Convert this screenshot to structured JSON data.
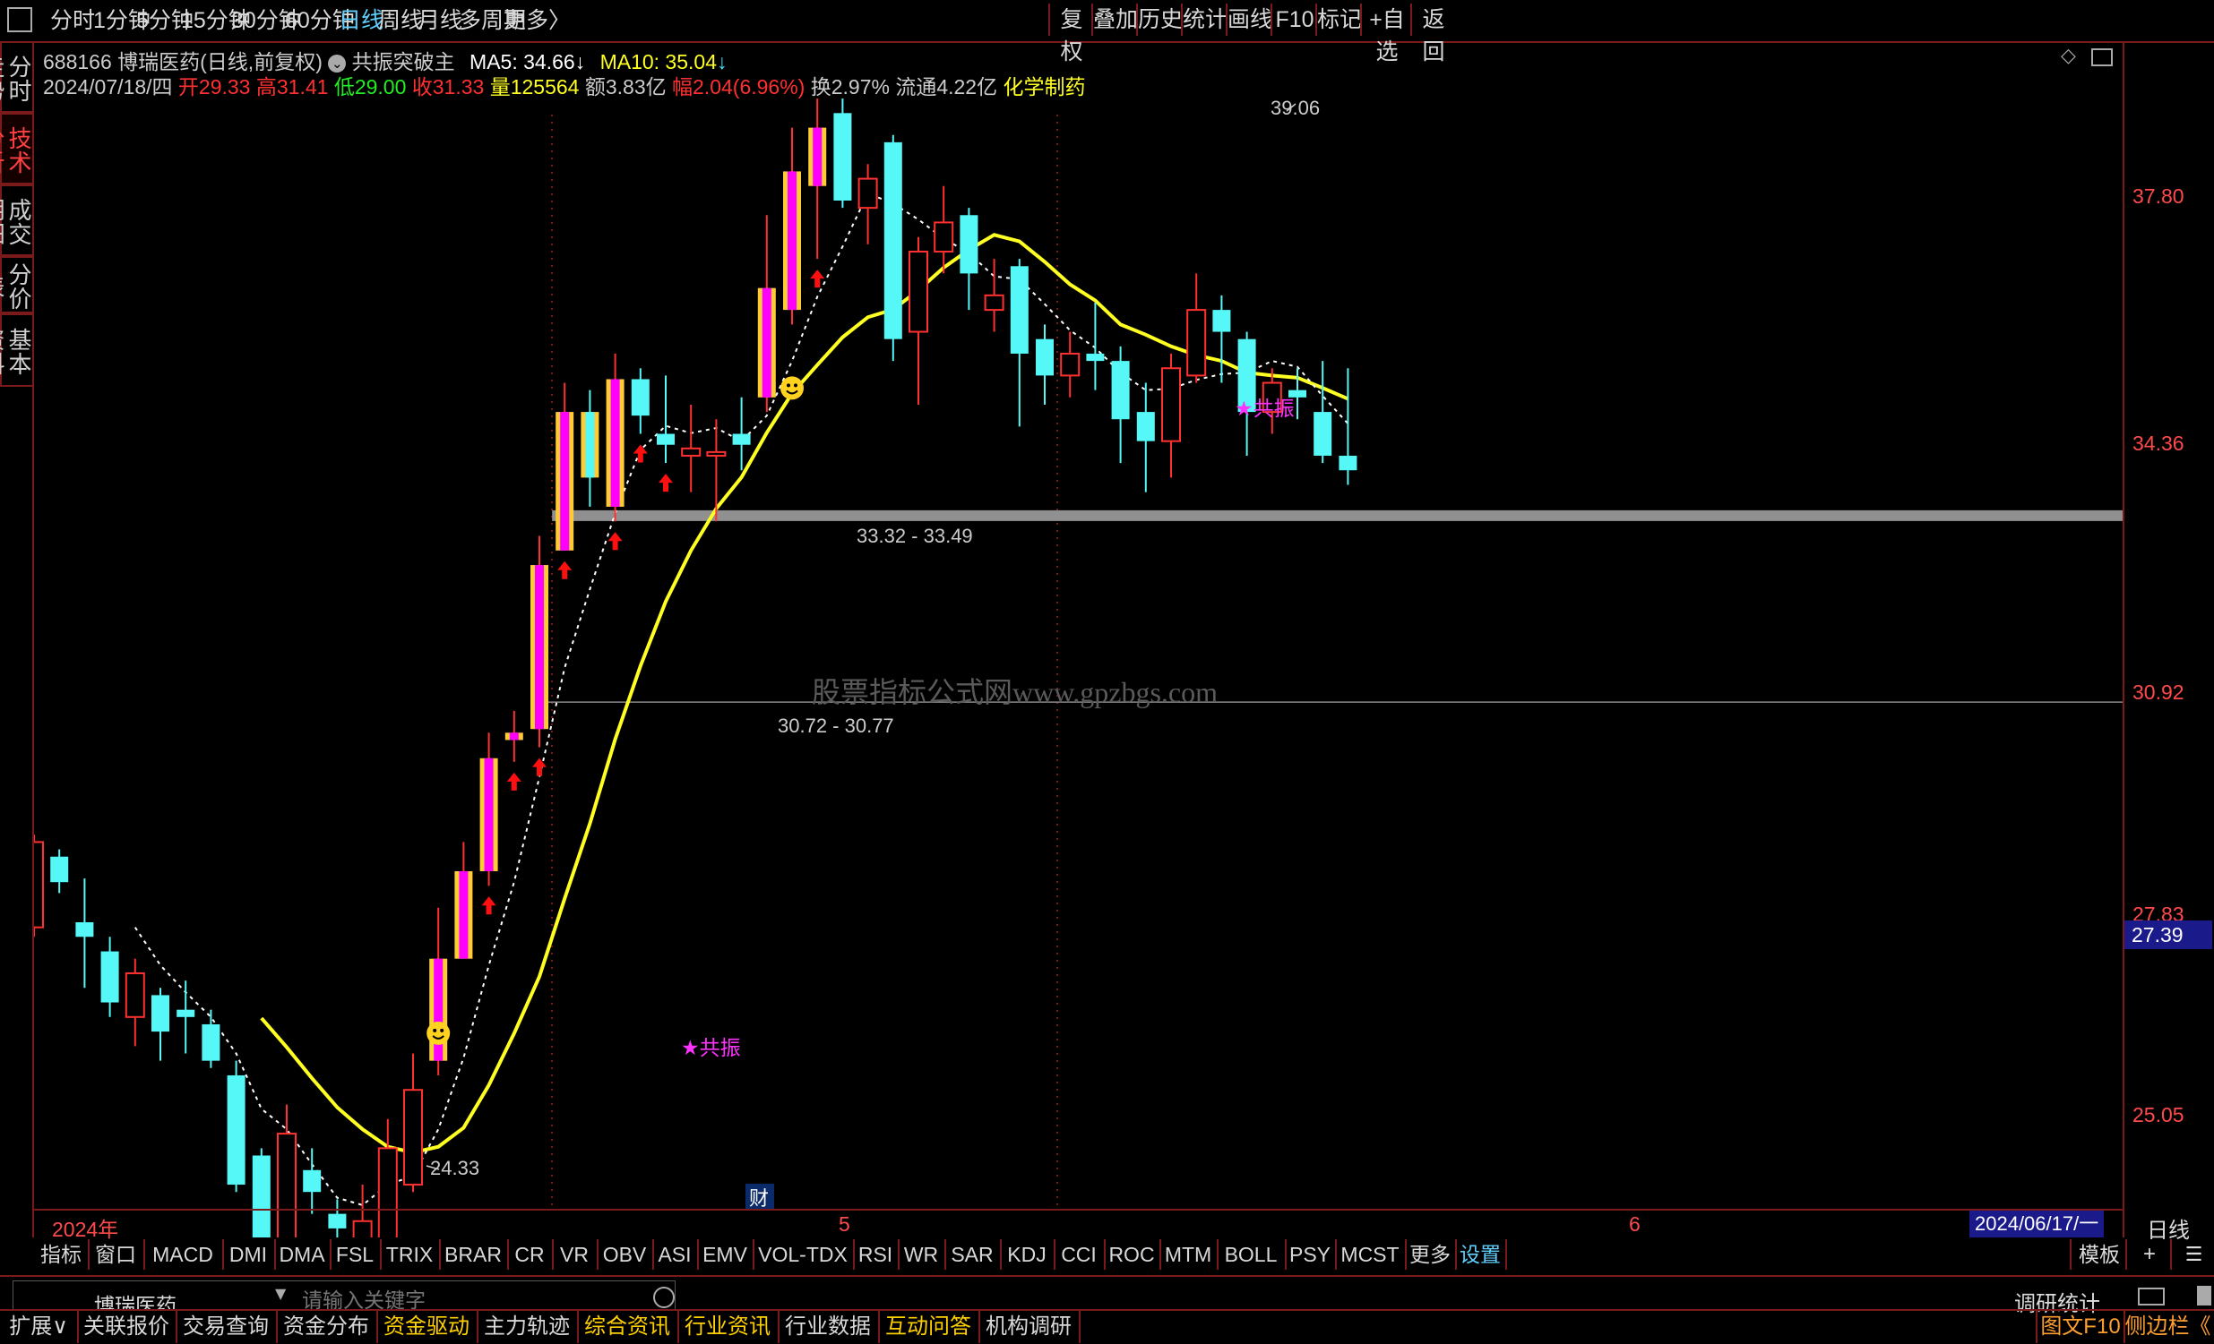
{
  "toolbar": {
    "periods": [
      "分时",
      "1分钟",
      "5分钟",
      "15分钟",
      "30分钟",
      "60分钟",
      "日线",
      "周线",
      "月线",
      "多周期",
      "更多"
    ],
    "active_period": "日线",
    "more_arrow": "〉",
    "right_buttons": [
      "复权",
      "叠加",
      "历史",
      "统计",
      "画线",
      "F10",
      "标记",
      "+自选",
      "返回"
    ]
  },
  "side_tabs": [
    {
      "label": "分时走势",
      "active": false
    },
    {
      "label": "技术分析",
      "active": true
    },
    {
      "label": "成交明细",
      "active": false
    },
    {
      "label": "分价表",
      "active": false
    },
    {
      "label": "基本资料",
      "active": false
    }
  ],
  "stock": {
    "code": "688166",
    "name": "博瑞医药",
    "mode": "(日线,前复权)",
    "indicator_name": "共振突破主",
    "ma5_label": "MA5: 34.66",
    "ma10_label": "MA10: 35.04",
    "down_arrow": "↓"
  },
  "quote": {
    "date": "2024/07/18/四",
    "open_label": "开",
    "open": "29.33",
    "high_label": "高",
    "high": "31.41",
    "low_label": "低",
    "low": "29.00",
    "close_label": "收",
    "close": "31.33",
    "vol_label": "量",
    "vol": "125564",
    "amount_label": "额",
    "amount": "3.83亿",
    "change_label": "幅",
    "change": "2.04(6.96%)",
    "turnover_label": "换",
    "turnover": "2.97%",
    "float_label": "流通",
    "float": "4.22亿",
    "sector": "化学制药"
  },
  "chart_data": {
    "type": "candlestick",
    "y_ticks": [
      "37.80",
      "34.36",
      "30.92",
      "27.83",
      "25.05"
    ],
    "current_price_label": "27.39",
    "annotations": {
      "high": "39.06",
      "low": "24.33",
      "band_upper": "33.32 - 33.49",
      "band_lower": "30.72 - 30.77",
      "signal_1": "★共振",
      "signal_2": "★共振",
      "finance_marker": "财",
      "watermark": "股票指标公式网www.gpzbgs.com"
    },
    "x_labels": [
      "2024年",
      "5",
      "6"
    ],
    "cursor_date": "2024/06/17/一",
    "period_label": "日线",
    "colors": {
      "up": "#ff3030",
      "down": "#55f7f7",
      "ma_yellow": "#ffff22",
      "ma_white": "#ffffff",
      "signal": "#ff33ff",
      "magenta_fill": "#ff00ff",
      "gold_fill": "#ffcc33",
      "band": "#909090"
    },
    "candles": [
      {
        "o": 27.83,
        "c": 29.0,
        "h": 29.1,
        "l": 27.7
      },
      {
        "o": 28.8,
        "c": 28.45,
        "h": 28.9,
        "l": 28.3
      },
      {
        "o": 27.9,
        "c": 27.7,
        "h": 28.5,
        "l": 27.0
      },
      {
        "o": 27.5,
        "c": 26.8,
        "h": 27.7,
        "l": 26.6
      },
      {
        "o": 26.6,
        "c": 27.2,
        "h": 27.4,
        "l": 26.2
      },
      {
        "o": 26.9,
        "c": 26.4,
        "h": 27.0,
        "l": 26.0
      },
      {
        "o": 26.7,
        "c": 26.6,
        "h": 27.1,
        "l": 26.1
      },
      {
        "o": 26.5,
        "c": 26.0,
        "h": 26.7,
        "l": 25.9
      },
      {
        "o": 25.8,
        "c": 24.3,
        "h": 26.0,
        "l": 24.2
      },
      {
        "o": 24.7,
        "c": 23.4,
        "h": 24.8,
        "l": 22.8
      },
      {
        "o": 23.3,
        "c": 25.0,
        "h": 25.4,
        "l": 23.3
      },
      {
        "o": 24.5,
        "c": 24.2,
        "h": 24.8,
        "l": 23.9
      },
      {
        "o": 23.9,
        "c": 23.7,
        "h": 24.1,
        "l": 23.0
      },
      {
        "o": 23.5,
        "c": 23.8,
        "h": 24.3,
        "l": 23.1
      },
      {
        "o": 23.5,
        "c": 24.8,
        "h": 25.2,
        "l": 23.5
      },
      {
        "o": 24.3,
        "c": 25.6,
        "h": 26.1,
        "l": 24.2
      },
      {
        "o": 26.0,
        "c": 27.4,
        "h": 28.1,
        "l": 25.8
      },
      {
        "o": 27.4,
        "c": 28.6,
        "h": 29.0,
        "l": 27.4
      },
      {
        "o": 28.6,
        "c": 30.15,
        "h": 30.5,
        "l": 28.4
      },
      {
        "o": 30.4,
        "c": 30.5,
        "h": 30.8,
        "l": 30.1
      },
      {
        "o": 30.55,
        "c": 32.8,
        "h": 33.2,
        "l": 30.3
      },
      {
        "o": 33.0,
        "c": 34.9,
        "h": 35.3,
        "l": 33.0
      },
      {
        "o": 34.9,
        "c": 34.0,
        "h": 35.2,
        "l": 33.6
      },
      {
        "o": 33.6,
        "c": 35.35,
        "h": 35.7,
        "l": 33.4
      },
      {
        "o": 35.35,
        "c": 34.85,
        "h": 35.5,
        "l": 34.6
      },
      {
        "o": 34.6,
        "c": 34.45,
        "h": 35.4,
        "l": 34.2
      },
      {
        "o": 34.3,
        "c": 34.4,
        "h": 35.0,
        "l": 33.8
      },
      {
        "o": 34.3,
        "c": 34.35,
        "h": 34.8,
        "l": 33.4
      },
      {
        "o": 34.6,
        "c": 34.45,
        "h": 35.1,
        "l": 34.1
      },
      {
        "o": 35.1,
        "c": 36.6,
        "h": 37.6,
        "l": 34.9
      },
      {
        "o": 36.3,
        "c": 38.2,
        "h": 38.8,
        "l": 36.1
      },
      {
        "o": 38.0,
        "c": 38.8,
        "h": 39.2,
        "l": 37.0
      },
      {
        "o": 39.0,
        "c": 37.8,
        "h": 39.2,
        "l": 37.7
      },
      {
        "o": 37.7,
        "c": 38.1,
        "h": 38.3,
        "l": 37.2
      },
      {
        "o": 38.6,
        "c": 35.9,
        "h": 38.7,
        "l": 35.6
      },
      {
        "o": 36.0,
        "c": 37.1,
        "h": 37.3,
        "l": 35.0
      },
      {
        "o": 37.1,
        "c": 37.5,
        "h": 38.0,
        "l": 36.8
      },
      {
        "o": 37.6,
        "c": 36.8,
        "h": 37.7,
        "l": 36.3
      },
      {
        "o": 36.3,
        "c": 36.5,
        "h": 37.0,
        "l": 36.0
      },
      {
        "o": 36.9,
        "c": 35.7,
        "h": 37.0,
        "l": 34.7
      },
      {
        "o": 35.9,
        "c": 35.4,
        "h": 36.1,
        "l": 35.0
      },
      {
        "o": 35.4,
        "c": 35.7,
        "h": 36.0,
        "l": 35.1
      },
      {
        "o": 35.7,
        "c": 35.6,
        "h": 36.4,
        "l": 35.2
      },
      {
        "o": 35.6,
        "c": 34.8,
        "h": 35.8,
        "l": 34.2
      },
      {
        "o": 34.9,
        "c": 34.5,
        "h": 35.3,
        "l": 33.8
      },
      {
        "o": 34.5,
        "c": 35.5,
        "h": 35.7,
        "l": 34.0
      },
      {
        "o": 35.4,
        "c": 36.3,
        "h": 36.8,
        "l": 35.3
      },
      {
        "o": 36.3,
        "c": 36.0,
        "h": 36.5,
        "l": 35.3
      },
      {
        "o": 35.9,
        "c": 34.9,
        "h": 36.0,
        "l": 34.3
      },
      {
        "o": 34.9,
        "c": 35.3,
        "h": 35.5,
        "l": 34.6
      },
      {
        "o": 35.2,
        "c": 35.1,
        "h": 35.5,
        "l": 34.8
      },
      {
        "o": 34.9,
        "c": 34.3,
        "h": 35.6,
        "l": 34.2
      },
      {
        "o": 34.3,
        "c": 34.1,
        "h": 35.5,
        "l": 33.9
      }
    ]
  },
  "indicator_tabs": [
    "指标",
    "窗口",
    "MACD",
    "DMI",
    "DMA",
    "FSL",
    "TRIX",
    "BRAR",
    "CR",
    "VR",
    "OBV",
    "ASI",
    "EMV",
    "VOL-TDX",
    "RSI",
    "WR",
    "SAR",
    "KDJ",
    "CCI",
    "ROC",
    "MTM",
    "BOLL",
    "PSY",
    "MCST",
    "更多",
    "设置"
  ],
  "right_mini": {
    "template": "模板",
    "plus": "+",
    "expand": "☰"
  },
  "search_row": {
    "stock_name": "博瑞医药",
    "placeholder": "请输入关键字",
    "research": "调研统计"
  },
  "bottom_tabs": [
    {
      "label": "扩展∨",
      "style": "normal"
    },
    {
      "label": "关联报价",
      "style": "normal"
    },
    {
      "label": "交易查询",
      "style": "normal"
    },
    {
      "label": "资金分布",
      "style": "normal"
    },
    {
      "label": "资金驱动",
      "style": "gold"
    },
    {
      "label": "主力轨迹",
      "style": "normal"
    },
    {
      "label": "综合资讯",
      "style": "gold"
    },
    {
      "label": "行业资讯",
      "style": "gold"
    },
    {
      "label": "行业数据",
      "style": "normal"
    },
    {
      "label": "互动问答",
      "style": "gold"
    },
    {
      "label": "机构调研",
      "style": "normal"
    }
  ],
  "bottom_right": {
    "f10": "图文F10",
    "sidebar": "侧边栏《"
  }
}
